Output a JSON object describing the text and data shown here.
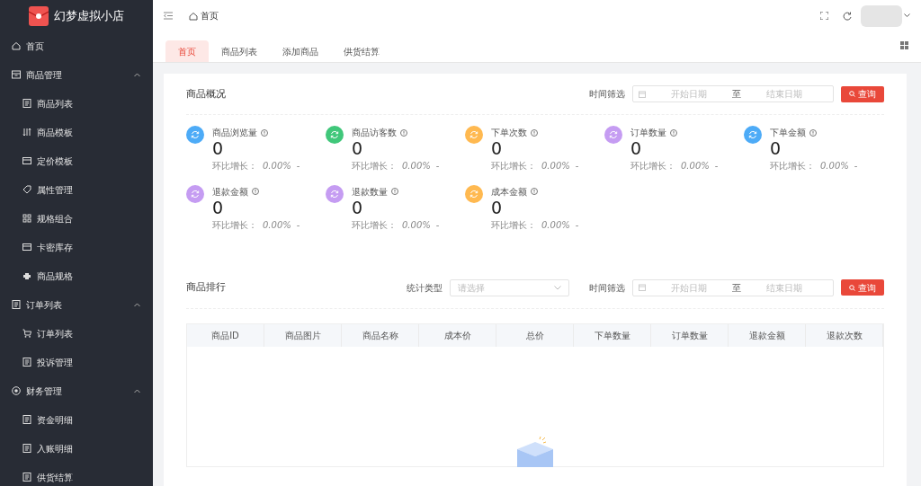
{
  "logo": {
    "text": "幻梦虚拟小店"
  },
  "sidebar": {
    "items": [
      {
        "label": "首页",
        "kind": "link"
      },
      {
        "label": "商品管理",
        "kind": "group",
        "expanded": true,
        "children": [
          {
            "label": "商品列表"
          },
          {
            "label": "商品模板"
          },
          {
            "label": "定价模板"
          },
          {
            "label": "属性管理"
          },
          {
            "label": "规格组合"
          },
          {
            "label": "卡密库存"
          },
          {
            "label": "商品规格"
          }
        ]
      },
      {
        "label": "订单列表",
        "kind": "group",
        "expanded": true,
        "children": [
          {
            "label": "订单列表"
          },
          {
            "label": "投诉管理"
          }
        ]
      },
      {
        "label": "财务管理",
        "kind": "group",
        "expanded": true,
        "children": [
          {
            "label": "资金明细"
          },
          {
            "label": "入账明细"
          },
          {
            "label": "供货结算"
          }
        ]
      }
    ]
  },
  "topbar": {
    "breadcrumb": "首页"
  },
  "tabs": [
    {
      "label": "首页",
      "selected": true
    },
    {
      "label": "商品列表",
      "selected": false
    },
    {
      "label": "添加商品",
      "selected": false
    },
    {
      "label": "供货结算",
      "selected": false
    }
  ],
  "overview": {
    "title": "商品概况",
    "filter_label": "时间筛选",
    "start_placeholder": "开始日期",
    "separator": "至",
    "end_placeholder": "结束日期",
    "button": "查询",
    "stats": [
      {
        "label": "商品浏览量",
        "value": "0",
        "growth_label": "环比增长：",
        "growth": "0.00%",
        "trend": "-",
        "color": "#4dabf7"
      },
      {
        "label": "商品访客数",
        "value": "0",
        "growth_label": "环比增长：",
        "growth": "0.00%",
        "trend": "-",
        "color": "#40c77a"
      },
      {
        "label": "下单次数",
        "value": "0",
        "growth_label": "环比增长：",
        "growth": "0.00%",
        "trend": "-",
        "color": "#ffb950"
      },
      {
        "label": "订单数量",
        "value": "0",
        "growth_label": "环比增长：",
        "growth": "0.00%",
        "trend": "-",
        "color": "#c59cf2"
      },
      {
        "label": "下单金额",
        "value": "0",
        "growth_label": "环比增长：",
        "growth": "0.00%",
        "trend": "-",
        "color": "#4dabf7"
      },
      {
        "label": "退款金额",
        "value": "0",
        "growth_label": "环比增长：",
        "growth": "0.00%",
        "trend": "-",
        "color": "#c59cf2"
      },
      {
        "label": "退款数量",
        "value": "0",
        "growth_label": "环比增长：",
        "growth": "0.00%",
        "trend": "-",
        "color": "#c59cf2"
      },
      {
        "label": "成本金额",
        "value": "0",
        "growth_label": "环比增长：",
        "growth": "0.00%",
        "trend": "-",
        "color": "#ffb950"
      }
    ]
  },
  "ranking": {
    "title": "商品排行",
    "type_label": "统计类型",
    "type_placeholder": "请选择",
    "filter_label": "时间筛选",
    "start_placeholder": "开始日期",
    "separator": "至",
    "end_placeholder": "结束日期",
    "button": "查询",
    "table": {
      "columns": [
        "商品ID",
        "商品图片",
        "商品名称",
        "成本价",
        "总价",
        "下单数量",
        "订单数量",
        "退款金额",
        "退款次数"
      ]
    }
  }
}
